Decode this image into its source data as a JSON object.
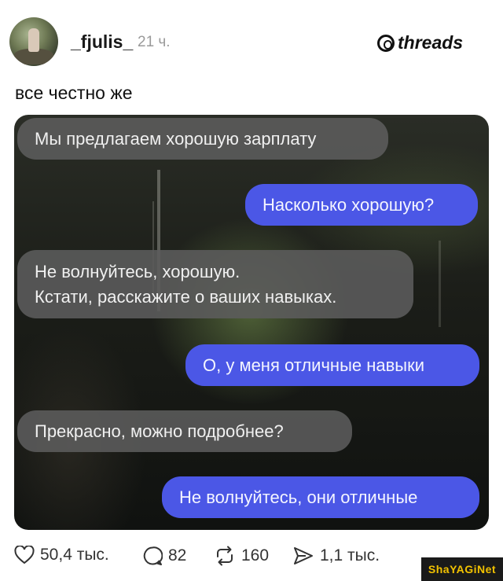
{
  "post": {
    "username": "_fjulis_",
    "time": "21 ч.",
    "brand": "threads",
    "text": "все честно же"
  },
  "chat": {
    "messages": [
      {
        "side": "in",
        "text": "Мы предлагаем хорошую зарплату"
      },
      {
        "side": "out",
        "text": "Насколько хорошую?"
      },
      {
        "side": "in",
        "text": "Не волнуйтесь, хорошую."
      },
      {
        "side": "in",
        "text": "Кстати, расскажите о ваших навыках."
      },
      {
        "side": "out",
        "text": "О, у меня отличные навыки"
      },
      {
        "side": "in",
        "text": "Прекрасно, можно подробнее?"
      },
      {
        "side": "out",
        "text": "Не волнуйтесь, они отличные"
      }
    ]
  },
  "actions": {
    "likes": "50,4 тыс.",
    "comments": "82",
    "reposts": "160",
    "shares": "1,1 тыс."
  },
  "watermark": "ShaYAGiNet",
  "colors": {
    "outgoing_bubble": "#4b57e6",
    "incoming_bubble": "#5c5c5c"
  }
}
